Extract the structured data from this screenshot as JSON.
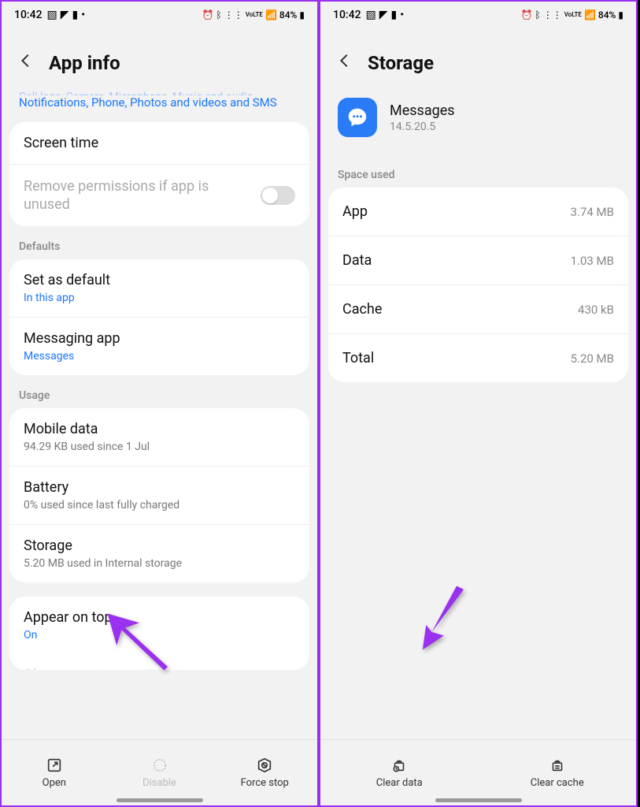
{
  "status": {
    "time": "10:42",
    "battery": "84%",
    "indicators": [
      "alarm-icon",
      "bluetooth-icon",
      "volte-icon",
      "signal-icon",
      "battery-icon"
    ]
  },
  "left": {
    "title": "App info",
    "perm_line1_clipped": "Call logs, Camera, Microphone, Music and audio,",
    "perm_line2": "Notifications, Phone, Photos and videos and SMS",
    "screen_time": "Screen time",
    "remove_perm": "Remove permissions if app is unused",
    "sections": {
      "defaults": "Defaults",
      "usage": "Usage"
    },
    "defaults": {
      "set_as_default": "Set as default",
      "set_as_default_sub": "In this app",
      "messaging_app": "Messaging app",
      "messaging_app_sub": "Messages"
    },
    "usage": {
      "mobile_data": "Mobile data",
      "mobile_data_sub": "94.29 KB used since 1 Jul",
      "battery": "Battery",
      "battery_sub": "0% used since last fully charged",
      "storage": "Storage",
      "storage_sub": "5.20 MB used in Internal storage"
    },
    "appear_on_top": "Appear on top",
    "appear_on_top_sub": "On",
    "change_system": "Change system settings",
    "bottom": {
      "open": "Open",
      "disable": "Disable",
      "force_stop": "Force stop"
    }
  },
  "right": {
    "title": "Storage",
    "app": {
      "name": "Messages",
      "version": "14.5.20.5"
    },
    "section": "Space used",
    "rows": {
      "app": {
        "k": "App",
        "v": "3.74 MB"
      },
      "data": {
        "k": "Data",
        "v": "1.03 MB"
      },
      "cache": {
        "k": "Cache",
        "v": "430 kB"
      },
      "total": {
        "k": "Total",
        "v": "5.20 MB"
      }
    },
    "bottom": {
      "clear_data": "Clear data",
      "clear_cache": "Clear cache"
    }
  }
}
